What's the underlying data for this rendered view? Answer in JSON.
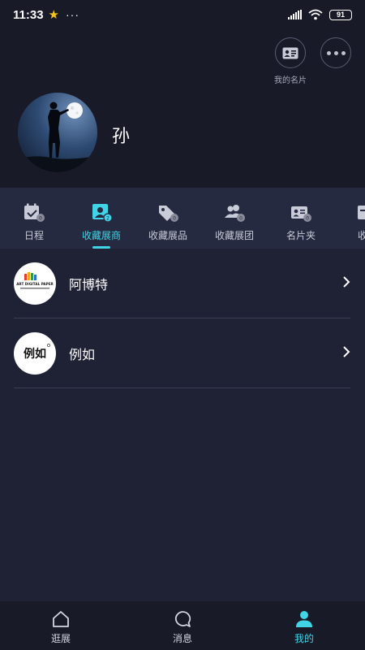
{
  "status_bar": {
    "time": "11:33",
    "battery": "91"
  },
  "header": {
    "card_button_label": "我的名片",
    "user_name": "孙"
  },
  "tabs": [
    {
      "label": "日程",
      "active": false
    },
    {
      "label": "收藏展商",
      "active": true
    },
    {
      "label": "收藏展品",
      "active": false
    },
    {
      "label": "收藏展团",
      "active": false
    },
    {
      "label": "名片夹",
      "active": false
    },
    {
      "label": "收藏",
      "active": false
    }
  ],
  "list": [
    {
      "name": "阿博特",
      "logo_text": "ART DIGITAL PAPER"
    },
    {
      "name": "例如",
      "logo_text": "例如"
    }
  ],
  "bottom_nav": [
    {
      "label": "逛展",
      "icon": "home-icon"
    },
    {
      "label": "消息",
      "icon": "message-icon"
    },
    {
      "label": "我的",
      "icon": "person-icon"
    }
  ],
  "colors": {
    "accent": "#40d4e6",
    "background": "#1f2135",
    "header_bg": "#191a28",
    "tab_bg": "#262a40"
  }
}
